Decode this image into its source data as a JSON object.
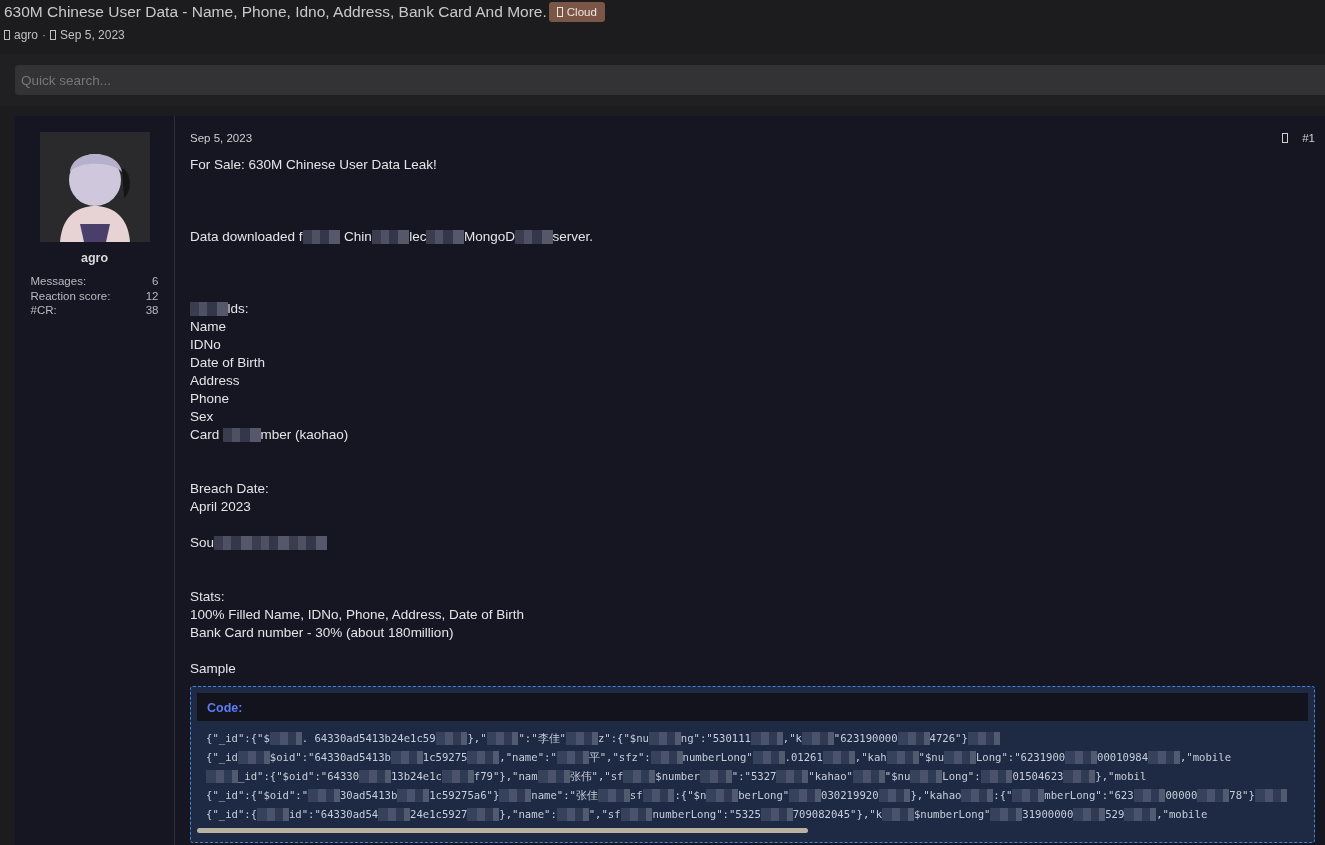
{
  "thread": {
    "title": "630M Chinese User Data - Name, Phone, Idno, Address, Bank Card And More.",
    "tag": "Cloud",
    "author": "agro",
    "separator": "·",
    "date": "Sep 5, 2023"
  },
  "search": {
    "placeholder": "Quick search..."
  },
  "post": {
    "user": {
      "name": "agro",
      "stats": [
        {
          "label": "Messages:",
          "value": "6"
        },
        {
          "label": "Reaction score:",
          "value": "12"
        },
        {
          "label": "#CR:",
          "value": "38"
        }
      ]
    },
    "date": "Sep 5, 2023",
    "number": "#1",
    "blocks": [
      {
        "lines": [
          [
            {
              "text": "For Sale: 630M Chinese User Data Leak!"
            }
          ]
        ]
      },
      {
        "lines": [
          [
            {
              "text": "Data downloaded f"
            },
            {
              "kind": "redacted"
            },
            {
              "text": " Chin"
            },
            {
              "kind": "redacted"
            },
            {
              "text": "lec"
            },
            {
              "kind": "redacted"
            },
            {
              "text": "MongoD"
            },
            {
              "kind": "redacted"
            },
            {
              "text": "server."
            }
          ]
        ]
      },
      {
        "lines": [
          [
            {
              "kind": "redacted"
            },
            {
              "text": "lds:"
            }
          ],
          [
            {
              "text": "Name"
            }
          ],
          [
            {
              "text": "IDNo"
            }
          ],
          [
            {
              "text": "Date of Birth"
            }
          ],
          [
            {
              "text": "Address"
            }
          ],
          [
            {
              "text": "Phone"
            }
          ],
          [
            {
              "text": "Sex"
            }
          ],
          [
            {
              "text": "Card "
            },
            {
              "kind": "redacted"
            },
            {
              "text": "mber (kaohao)"
            }
          ]
        ]
      },
      {
        "lines": [
          [
            {
              "text": "Breach Date:"
            }
          ],
          [
            {
              "text": "April 2023"
            }
          ]
        ]
      },
      {
        "lines": [
          [
            {
              "text": "Sou"
            },
            {
              "kind": "redacted"
            },
            {
              "kind": "redacted"
            },
            {
              "kind": "redacted"
            }
          ]
        ]
      },
      {
        "lines": [
          [
            {
              "text": "Stats:"
            }
          ],
          [
            {
              "text": "100% Filled Name, IDNo, Phone, Address, Date of Birth"
            }
          ],
          [
            {
              "text": "Bank Card number - 30% (about 180million)"
            }
          ]
        ]
      },
      {
        "lines": [
          [
            {
              "text": "Sample"
            }
          ]
        ]
      }
    ],
    "code": {
      "label": "Code:",
      "lines": [
        [
          {
            "text": "{\"_id\":{\"$"
          },
          {
            "kind": "redacted"
          },
          {
            "text": ". 64330ad5413b24e1c59"
          },
          {
            "kind": "redacted"
          },
          {
            "text": "},\""
          },
          {
            "kind": "redacted"
          },
          {
            "text": "\":\"李佳\""
          },
          {
            "kind": "redacted"
          },
          {
            "text": "z\":{\"$nu"
          },
          {
            "kind": "redacted"
          },
          {
            "text": "ng\":\"530111"
          },
          {
            "kind": "redacted"
          },
          {
            "text": ",\"k"
          },
          {
            "kind": "redacted"
          },
          {
            "text": "\"623190000"
          },
          {
            "kind": "redacted"
          },
          {
            "text": "4726\"}"
          },
          {
            "kind": "redacted"
          }
        ],
        [
          {
            "text": "{\"_id"
          },
          {
            "kind": "redacted"
          },
          {
            "text": "$oid\":\"64330ad5413b"
          },
          {
            "kind": "redacted"
          },
          {
            "text": "1c59275"
          },
          {
            "kind": "redacted"
          },
          {
            "text": ",\"name\":\""
          },
          {
            "kind": "redacted"
          },
          {
            "text": "平\",\"sfz\":"
          },
          {
            "kind": "redacted"
          },
          {
            "text": "numberLong\""
          },
          {
            "kind": "redacted"
          },
          {
            "text": ".01261"
          },
          {
            "kind": "redacted"
          },
          {
            "text": ",\"kah"
          },
          {
            "kind": "redacted"
          },
          {
            "text": "\"$nu"
          },
          {
            "kind": "redacted"
          },
          {
            "text": "Long\":\"6231900"
          },
          {
            "kind": "redacted"
          },
          {
            "text": "00010984"
          },
          {
            "kind": "redacted"
          },
          {
            "text": ",\"mobile"
          }
        ],
        [
          {
            "kind": "redacted"
          },
          {
            "text": "_id\":{\"$oid\":\"64330"
          },
          {
            "kind": "redacted"
          },
          {
            "text": "13b24e1c"
          },
          {
            "kind": "redacted"
          },
          {
            "text": "f79\"},\"nam"
          },
          {
            "kind": "redacted"
          },
          {
            "text": "张伟\",\"sf"
          },
          {
            "kind": "redacted"
          },
          {
            "text": "$number"
          },
          {
            "kind": "redacted"
          },
          {
            "text": "\":\"5327"
          },
          {
            "kind": "redacted"
          },
          {
            "text": "\"kahao\""
          },
          {
            "kind": "redacted"
          },
          {
            "text": "\"$nu"
          },
          {
            "kind": "redacted"
          },
          {
            "text": "Long\":"
          },
          {
            "kind": "redacted"
          },
          {
            "text": "01504623"
          },
          {
            "kind": "redacted"
          },
          {
            "text": "},\"mobil"
          }
        ],
        [
          {
            "text": "{\"_id\":{\"$oid\":\""
          },
          {
            "kind": "redacted"
          },
          {
            "text": "30ad5413b"
          },
          {
            "kind": "redacted"
          },
          {
            "text": "1c59275a6\"}"
          },
          {
            "kind": "redacted"
          },
          {
            "text": "name\":\"张佳"
          },
          {
            "kind": "redacted"
          },
          {
            "text": "sf"
          },
          {
            "kind": "redacted"
          },
          {
            "text": ":{\"$n"
          },
          {
            "kind": "redacted"
          },
          {
            "text": "berLong\""
          },
          {
            "kind": "redacted"
          },
          {
            "text": "030219920"
          },
          {
            "kind": "redacted"
          },
          {
            "text": "},\"kahao"
          },
          {
            "kind": "redacted"
          },
          {
            "text": ":{\""
          },
          {
            "kind": "redacted"
          },
          {
            "text": "mberLong\":\"623"
          },
          {
            "kind": "redacted"
          },
          {
            "text": "00000"
          },
          {
            "kind": "redacted"
          },
          {
            "text": "78\"}"
          },
          {
            "kind": "redacted"
          }
        ],
        [
          {
            "text": "{\"_id\":{"
          },
          {
            "kind": "redacted"
          },
          {
            "text": "id\":\"64330ad54"
          },
          {
            "kind": "redacted"
          },
          {
            "text": "24e1c5927"
          },
          {
            "kind": "redacted"
          },
          {
            "text": "},\"name\":"
          },
          {
            "kind": "redacted"
          },
          {
            "text": "\",\"sf"
          },
          {
            "kind": "redacted"
          },
          {
            "text": "numberLong\":\"5325"
          },
          {
            "kind": "redacted"
          },
          {
            "text": "709082045\"},\"k"
          },
          {
            "kind": "redacted"
          },
          {
            "text": "$numberLong\""
          },
          {
            "kind": "redacted"
          },
          {
            "text": "31900000"
          },
          {
            "kind": "redacted"
          },
          {
            "text": "529"
          },
          {
            "kind": "redacted"
          },
          {
            "text": ",\"mobile"
          }
        ]
      ]
    }
  }
}
